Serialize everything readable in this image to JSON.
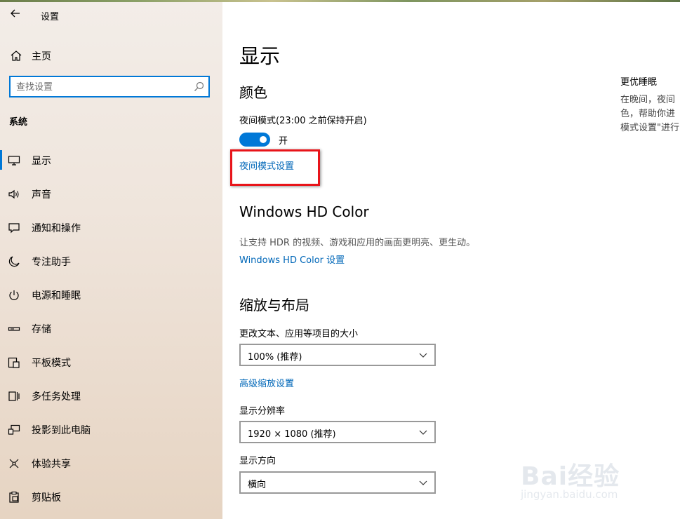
{
  "window": {
    "title": "设置"
  },
  "sidebar": {
    "home_label": "主页",
    "search_placeholder": "查找设置",
    "section": "系统",
    "items": [
      {
        "label": "显示",
        "icon": "monitor-icon",
        "active": true
      },
      {
        "label": "声音",
        "icon": "speaker-icon"
      },
      {
        "label": "通知和操作",
        "icon": "chat-bubble-icon"
      },
      {
        "label": "专注助手",
        "icon": "moon-icon"
      },
      {
        "label": "电源和睡眠",
        "icon": "power-icon"
      },
      {
        "label": "存储",
        "icon": "storage-drive-icon"
      },
      {
        "label": "平板模式",
        "icon": "tablet-icon"
      },
      {
        "label": "多任务处理",
        "icon": "multitask-icon"
      },
      {
        "label": "投影到此电脑",
        "icon": "project-icon"
      },
      {
        "label": "体验共享",
        "icon": "share-nodes-icon"
      },
      {
        "label": "剪贴板",
        "icon": "clipboard-icon"
      }
    ]
  },
  "main": {
    "title": "显示",
    "color_section": "颜色",
    "night_light_label": "夜间模式(23:00 之前保持开启)",
    "night_light_state": "开",
    "night_light_on": true,
    "night_light_settings_link": "夜间模式设置",
    "hdr_section": "Windows HD Color",
    "hdr_description": "让支持 HDR 的视频、游戏和应用的画面更明亮、更生动。",
    "hdr_settings_link": "Windows HD Color 设置",
    "scale_section": "缩放与布局",
    "scale_label": "更改文本、应用等项目的大小",
    "scale_value": "100% (推荐)",
    "advanced_scale_link": "高级缩放设置",
    "resolution_label": "显示分辨率",
    "resolution_value": "1920 × 1080 (推荐)",
    "orientation_label": "显示方向",
    "orientation_value": "横向"
  },
  "aside": {
    "title": "更优睡眠",
    "lines": [
      "在晚间，夜间",
      "色，帮助你进",
      "模式设置\"进行"
    ]
  },
  "watermark": {
    "brand": "Bai经验",
    "url": "jingyan.baidu.com"
  },
  "colors": {
    "accent": "#0078d7",
    "link": "#0067b8",
    "highlight": "#e8141a"
  }
}
